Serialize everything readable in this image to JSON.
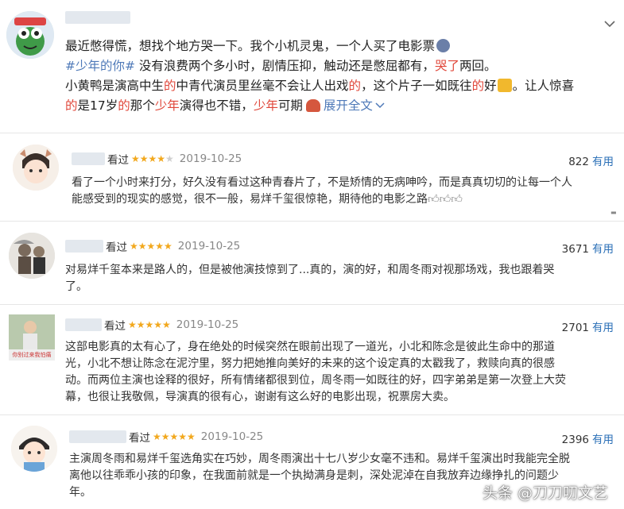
{
  "post": {
    "line1": "最近憋得慌，想找个地方哭一下。我个小机灵鬼，一个人买了电影票",
    "hashtag": "#少年的你#",
    "line2": "没有浪费两个多小时，剧情压抑，触动还是憋屈都有，",
    "line2_red": "哭了",
    "line2_end": "两回。",
    "line3_a": "小黄鸭是演高中生",
    "line3_b": "的",
    "line3_c": "中青代演员里丝毫不会让人出戏",
    "line3_d": "的",
    "line3_e": "，这个片子一如既往",
    "line3_f": "的",
    "line3_g": "好",
    "line3_h": "。让人惊喜",
    "line4_a": "的",
    "line4_b": "是17岁",
    "line4_c": "的",
    "line4_d": "那个",
    "line4_e": "少年",
    "line4_f": "演得也不错，",
    "line4_g": "少年",
    "line4_h": "可期",
    "expand_label": "展开全文"
  },
  "reviews": [
    {
      "status": "看过",
      "stars": 4,
      "date": "2019-10-25",
      "useful_count": "822",
      "useful_label": "有用",
      "lines": [
        "看了一个小时来打分，好久没有看过这种青春片了，不是矫情的无病呻吟，而是真真切切的让每一个人",
        "能感受到的现实的感觉，很不一般，易烊千玺很惊艳，期待他的电影之路"
      ]
    },
    {
      "status": "看过",
      "stars": 5,
      "date": "2019-10-25",
      "useful_count": "3671",
      "useful_label": "有用",
      "lines": [
        "对易烊千玺本来是路人的，但是被他演技惊到了...真的，演的好，和周冬雨对视那场戏，我也跟着哭",
        "了。"
      ]
    },
    {
      "status": "看过",
      "stars": 5,
      "date": "2019-10-25",
      "useful_count": "2701",
      "useful_label": "有用",
      "avatar_caption": "你别过来我怕痛",
      "lines": [
        "这部电影真的太有心了，身在绝处的时候突然在眼前出现了一道光，小北和陈念是彼此生命中的那道",
        "光，小北不想让陈念在泥泞里，努力把她推向美好的未来的这个设定真的太戳我了，救赎向真的很感",
        "动。而两位主演也诠释的很好，所有情绪都很到位，周冬雨一如既往的好，四字弟弟是第一次登上大荧",
        "幕，也很让我敬佩，导演真的很有心，谢谢有这么好的电影出现，祝票房大卖。"
      ]
    },
    {
      "status": "看过",
      "stars": 5,
      "date": "2019-10-25",
      "useful_count": "2396",
      "useful_label": "有用",
      "lines": [
        "主演周冬雨和易烊千玺选角实在巧妙，周冬雨演出十七八岁少女毫不违和。易烊千玺演出时我能完全脱",
        "离他以往乖乖小孩的印象，在我面前就是一个执拗满身是刺，深处泥淖在自我放弃边缘挣扎的问题少",
        "年。"
      ]
    }
  ],
  "watermark": "头条 @刀刀叨文艺",
  "colors": {
    "link": "#4e79b8",
    "red": "#e0473a",
    "star": "#f2a81d",
    "useful": "#2a6fb7"
  }
}
